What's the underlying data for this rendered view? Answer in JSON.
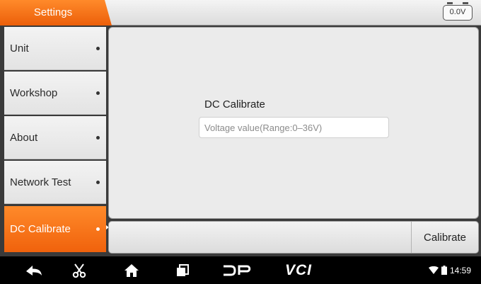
{
  "header": {
    "title": "Settings",
    "voltage": "0.0V",
    "accent": "#f26a10"
  },
  "sidebar": {
    "items": [
      {
        "label": "Unit",
        "active": false
      },
      {
        "label": "Workshop",
        "active": false
      },
      {
        "label": "About",
        "active": false
      },
      {
        "label": "Network Test",
        "active": false
      },
      {
        "label": "DC Calibrate",
        "active": true
      }
    ]
  },
  "main": {
    "title": "DC Calibrate",
    "input": {
      "value": "",
      "placeholder": "Voltage value(Range:0–36V)"
    }
  },
  "actionbar": {
    "calibrate_label": "Calibrate"
  },
  "navbar": {
    "icons": [
      "back-icon",
      "scissors-icon",
      "home-icon",
      "recent-apps-icon",
      "dp-logo-icon",
      "vci-logo"
    ],
    "vci_label": "VCI",
    "status": {
      "wifi": "wifi-icon",
      "battery": "battery-icon",
      "time": "14:59"
    }
  }
}
